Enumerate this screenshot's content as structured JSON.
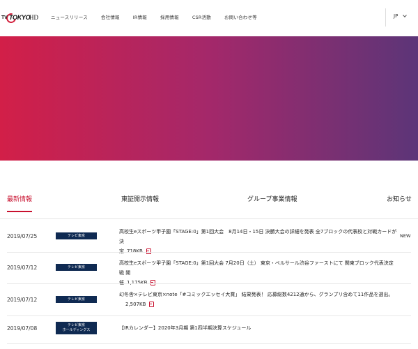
{
  "header": {
    "logo": {
      "tv": "TV",
      "tokyo": "TOKYO",
      "hd": "HD"
    },
    "nav": [
      "ニュースリリース",
      "会社情報",
      "IR情報",
      "採用情報",
      "CSR活動",
      "お問い合わせ等"
    ],
    "lang": "JP"
  },
  "tabs": [
    "最新情報",
    "東証開示情報",
    "グループ事業情報",
    "お知らせ"
  ],
  "colors": {
    "accent": "#c8102e",
    "tag_bg": "#0f2a52",
    "hero_start": "#d21f48",
    "hero_end": "#5c3578"
  },
  "news": [
    {
      "date": "2019/07/25",
      "tag": [
        "テレビ東京"
      ],
      "title_line1": "高校生eスポーツ甲子園「STAGE:0」第1回大会　8月14日・15日 決勝大会の詳細を発表 全7ブロックの代表校と対戦カードが決",
      "title_line2": "定",
      "size": "718KB",
      "badge": "NEW"
    },
    {
      "date": "2019/07/12",
      "tag": [
        "テレビ東京"
      ],
      "title_line1": "高校生eスポーツ甲子園「STAGE:0」第1回大会 7月20日（土） 東京・ベルサール渋谷ファーストにて 関東ブロック代表決定戦 開",
      "title_line2": "催",
      "size": "1,175KB"
    },
    {
      "date": "2019/07/12",
      "tag": [
        "テレビ東京"
      ],
      "title_line1": "幻冬舎×テレビ東京×note「#コミックエッセイ大賞」 結果発表！ 応募総数4212通から、グランプリ含めて11作品を選出。",
      "title_line2": "",
      "size": "2,507KB"
    },
    {
      "date": "2019/07/08",
      "tag": [
        "テレビ東京",
        "ホールディングス"
      ],
      "title_line1": "【IRカレンダー】2020年3月期 第1四半期決算スケジュール",
      "title_line2": ""
    }
  ]
}
